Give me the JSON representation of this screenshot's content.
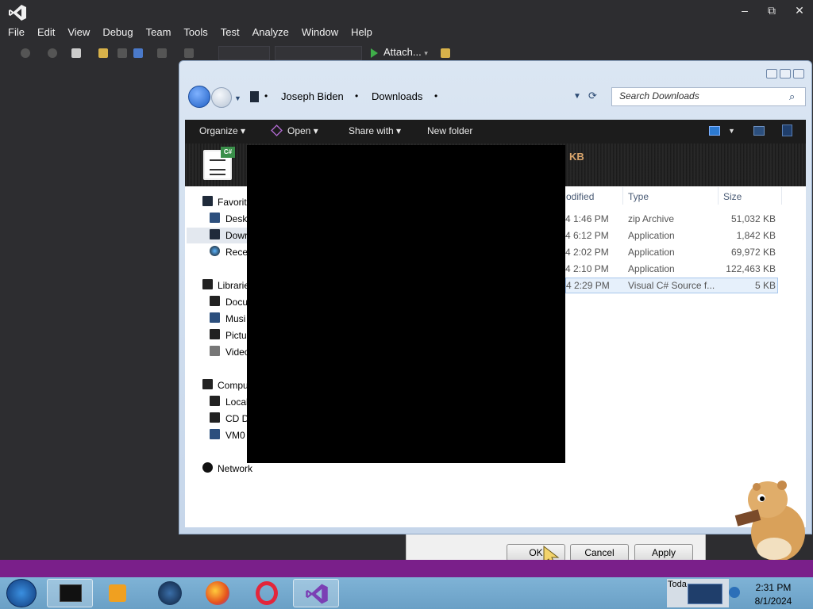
{
  "vs": {
    "menu": [
      "File",
      "Edit",
      "View",
      "Debug",
      "Team",
      "Tools",
      "Test",
      "Analyze",
      "Window",
      "Help"
    ],
    "attach_label": "Attach...",
    "window_controls": {
      "minimize": "–",
      "maximize": "⧉",
      "close": "✕"
    }
  },
  "explorer": {
    "breadcrumb": [
      "Joseph Biden",
      "Downloads"
    ],
    "search_placeholder": "Search Downloads",
    "commands": {
      "organize": "Organize ▾",
      "open": "Open ▾",
      "share": "Share with ▾",
      "new_folder": "New folder"
    },
    "banner_size_text": "KB",
    "tree": {
      "favorites": "Favorit",
      "desktop": "Deskt",
      "downloads": "Dowr",
      "recent": "Recer",
      "libraries": "Librarie",
      "documents": "Docu",
      "music": "Musi",
      "pictures": "Pictu",
      "videos": "Video",
      "computer": "Compu",
      "local_disk": "Local",
      "cd_drive": "CD D",
      "vm_share": "VM0",
      "network": "Network"
    },
    "columns": {
      "modified": "odified",
      "type": "Type",
      "size": "Size"
    },
    "rows": [
      {
        "modified": "4 1:46 PM",
        "type": "zip Archive",
        "size": "51,032 KB"
      },
      {
        "modified": "4 6:12 PM",
        "type": "Application",
        "size": "1,842 KB"
      },
      {
        "modified": "4 2:02 PM",
        "type": "Application",
        "size": "69,972 KB"
      },
      {
        "modified": "4 2:10 PM",
        "type": "Application",
        "size": "122,463 KB"
      },
      {
        "modified": "4 2:29 PM",
        "type": "Visual C# Source f...",
        "size": "5 KB"
      }
    ]
  },
  "dialog": {
    "ok": "OK",
    "cancel": "Cancel",
    "apply": "Apply"
  },
  "taskbar": {
    "time": "2:31 PM",
    "date": "8/1/2024",
    "today": "Toda"
  },
  "colors": {
    "vs_bg": "#2d2d30",
    "accent_purple": "#7a1f8a",
    "taskbar_blue": "#6aa0c6"
  }
}
